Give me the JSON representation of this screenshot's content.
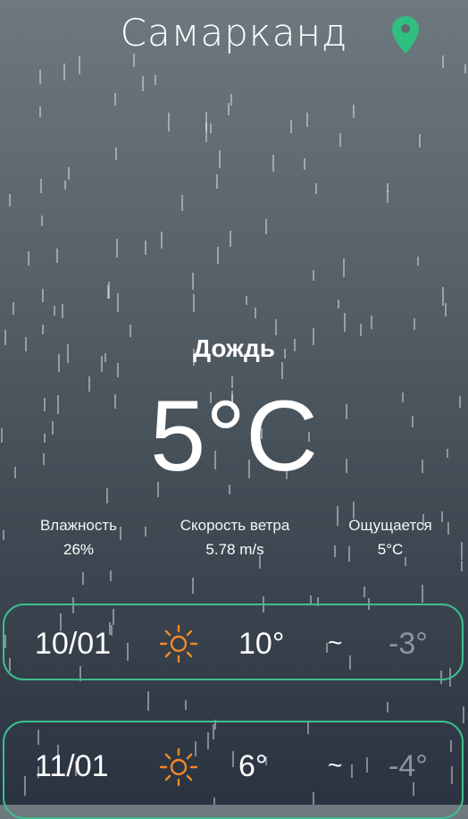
{
  "header": {
    "city": "Самарканд",
    "location_icon": "map-pin-icon",
    "pin_color": "#2fbf7f"
  },
  "current": {
    "condition": "Дождь",
    "temperature": "5°C"
  },
  "stats": [
    {
      "label": "Влажность",
      "value": "26%"
    },
    {
      "label": "Скорость ветра",
      "value": "5.78 m/s"
    },
    {
      "label": "Ощущается",
      "value": "5°C"
    }
  ],
  "forecast": [
    {
      "date": "10/01",
      "icon": "sun-icon",
      "high": "10°",
      "separator": "~",
      "low": "-3°"
    },
    {
      "date": "11/01",
      "icon": "sun-icon",
      "high": "6°",
      "separator": "~",
      "low": "-4°"
    }
  ],
  "colors": {
    "accent_border": "#3bc08e",
    "sun": "#f08a24",
    "low_temp": "#8d959c"
  }
}
